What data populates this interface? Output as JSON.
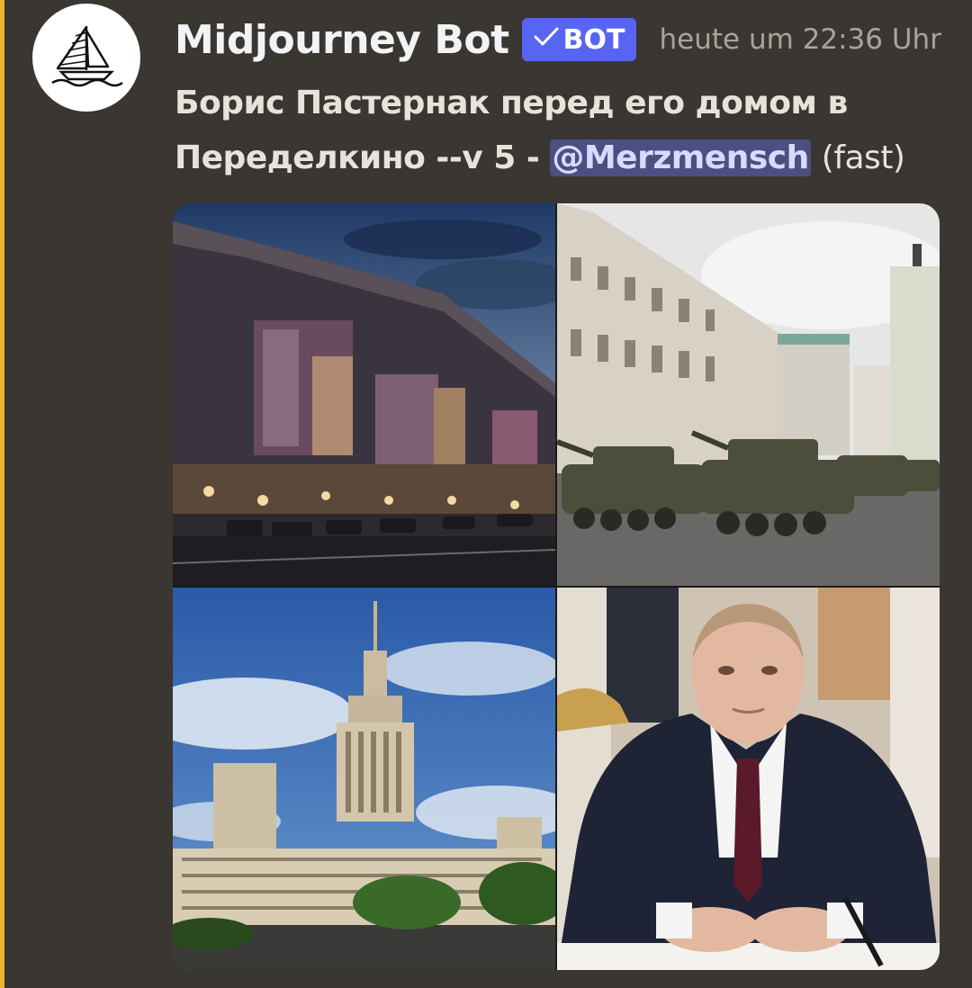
{
  "author": {
    "name": "Midjourney Bot",
    "avatar_icon": "sailboat-icon",
    "badge_label": "BOT",
    "badge_icon": "checkmark-icon"
  },
  "timestamp": "heute um 22:36 Uhr",
  "message": {
    "text_before": "Борис Пастернак перед его домом в Переделкино --v 5 - ",
    "mention": "@Merzmensch",
    "text_after": "(fast)"
  },
  "images": [
    {
      "icon": "stalinist-building-night-image"
    },
    {
      "icon": "military-tanks-parade-image"
    },
    {
      "icon": "moscow-university-tower-image"
    },
    {
      "icon": "man-in-suit-at-desk-image"
    }
  ],
  "colors": {
    "background": "#3a3631",
    "highlight_bar": "#f0b232",
    "badge": "#5865f2",
    "mention_bg": "#4b4f82"
  }
}
